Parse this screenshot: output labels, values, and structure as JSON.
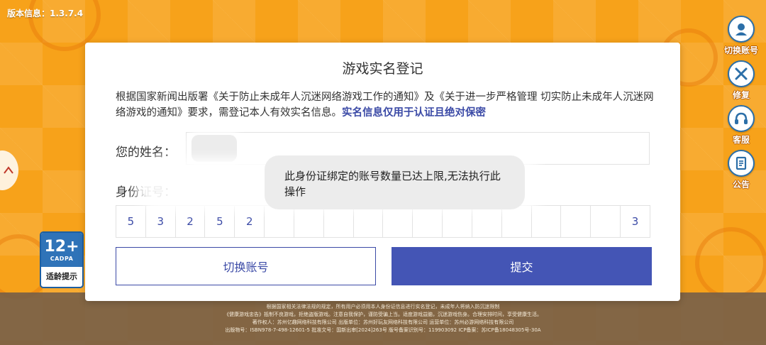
{
  "version_text": "版本信息：1.3.7.4",
  "side_menu": {
    "switch_account": "切换账号",
    "repair": "修复",
    "service": "客服",
    "announcement": "公告"
  },
  "age_rating": {
    "number": "12+",
    "org": "CADPA",
    "label": "适龄提示"
  },
  "dialog": {
    "title": "游戏实名登记",
    "notice_text": "根据国家新闻出版署《关于防止未成年人沉迷网络游戏工作的通知》及《关于进一步严格管理 切实防止未成年人沉迷网络游戏的通知》要求，需登记本人有效实名信息。",
    "notice_highlight": "实名信息仅用于认证且绝对保密",
    "name_label": "您的姓名：",
    "id_label": "身份证号：",
    "id_digits": [
      "5",
      "3",
      "2",
      "5",
      "2",
      "",
      "",
      "",
      "",
      "",
      "",
      "",
      "",
      "",
      "",
      "",
      "",
      "3"
    ],
    "switch_button": "切换账号",
    "submit_button": "提交"
  },
  "toast": {
    "message": "此身份证绑定的账号数量已达上限,无法执行此操作"
  },
  "footer": {
    "line1": "根据国家相关法律法规的规定，所有用户必须用本人身份证信息进行实名登记，未成年人将纳入防沉迷限制",
    "line2": "《健康游戏忠告》抵制不良游戏，拒绝盗版游戏。注意自我保护，谨防受骗上当。适度游戏益脑，沉迷游戏伤身。合理安排时间，享受健康生活。",
    "line3": "著作权人：苏州亿趣网络科技有限公司 出版单位：苏州好玩友网络科技有限公司 运营单位：苏州必游网络科技有限公司",
    "line4": "出版物号：ISBN978-7-498-12601-5 批准文号：国新出审[2024]263号 版号备案识别号：119903092 ICP备案：苏ICP备18048305号-30A"
  },
  "colors": {
    "background": "#f7a21a",
    "accent": "#4455b5",
    "highlight": "#3b4aa6"
  }
}
